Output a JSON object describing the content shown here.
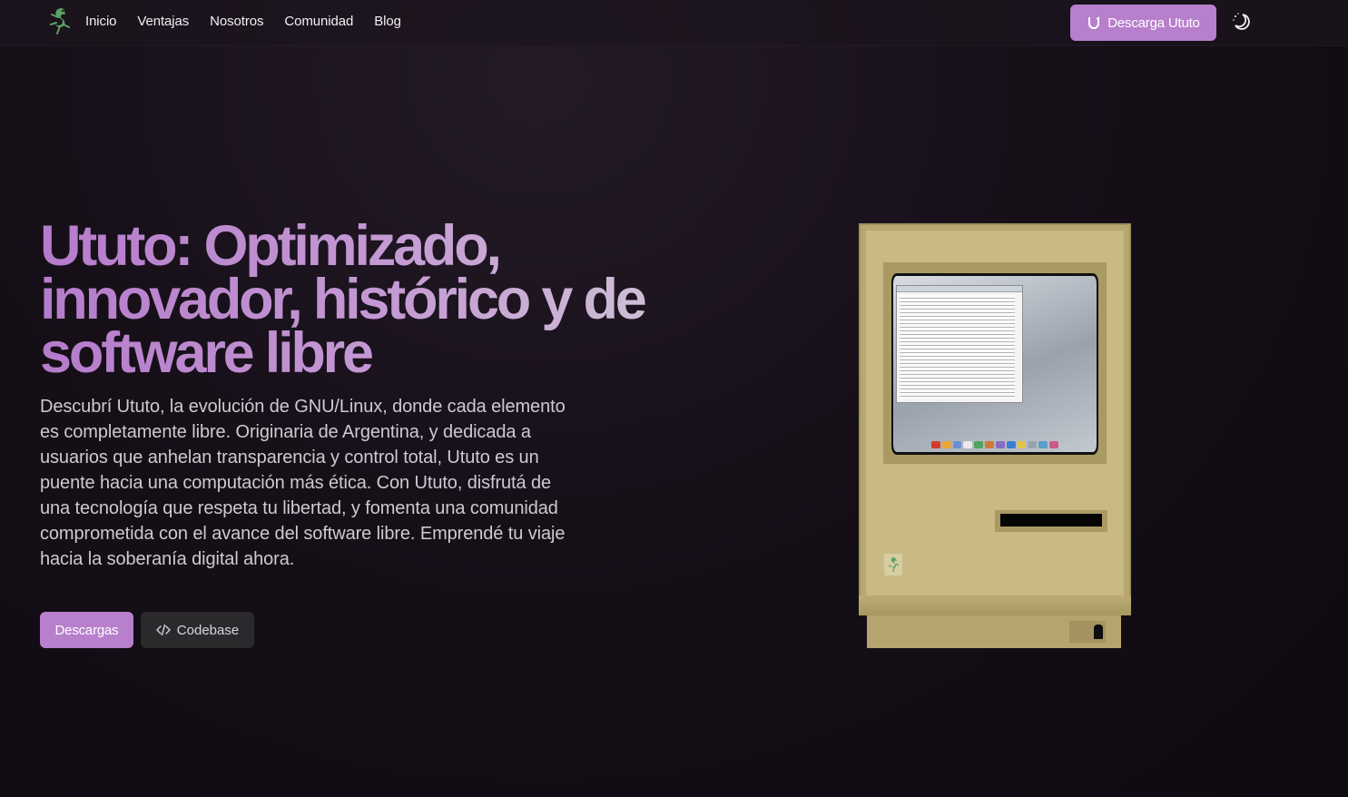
{
  "nav": {
    "links": [
      "Inicio",
      "Ventajas",
      "Nosotros",
      "Comunidad",
      "Blog"
    ],
    "download_label": "Descarga Ututo",
    "logo_icon": "ututo-gecko-icon",
    "theme_icon": "moon-stars-icon"
  },
  "hero": {
    "title": "Ututo: Optimizado, innovador, histórico y de software libre",
    "description": "Descubrí Ututo, la evolución de GNU/Linux, donde cada elemento es completamente libre. Originaria de Argentina, y dedicada a usuarios que anhelan transparencia y control total, Ututo es un puente hacia una computación más ética. Con Ututo, disfrutá de una tecnología que respeta tu libertad, y fomenta una comunidad comprometida con el avance del software libre. Emprendé tu viaje hacia la soberanía digital ahora.",
    "primary_button": "Descargas",
    "secondary_button": "Codebase",
    "secondary_icon": "code-icon"
  },
  "illustration": {
    "name": "retro-macintosh-illustration"
  },
  "colors": {
    "accent": "#b87fcd",
    "background": "#160f18",
    "mac_beige": "#b7a870"
  }
}
